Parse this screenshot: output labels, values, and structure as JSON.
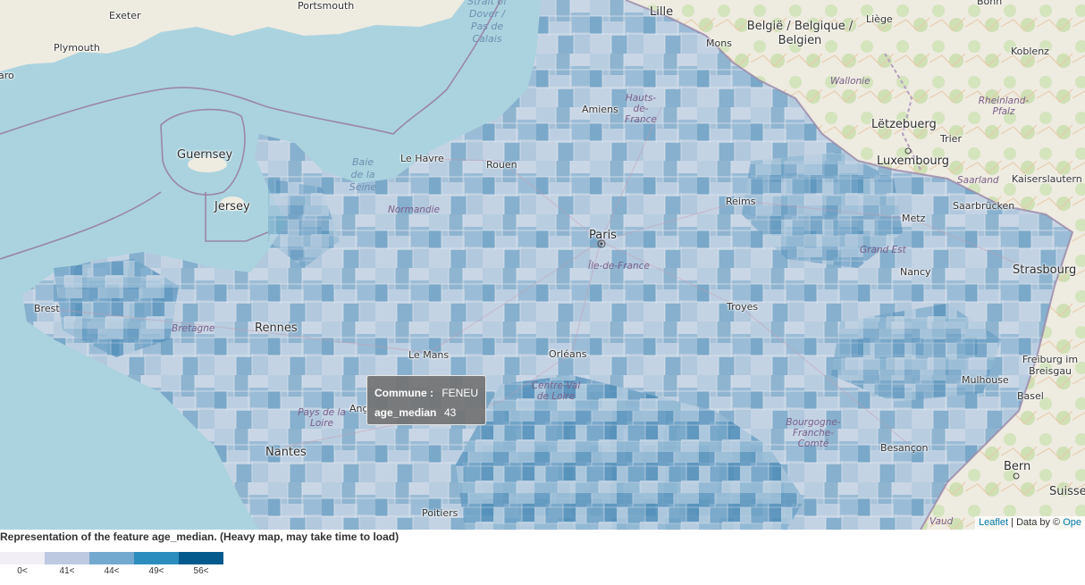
{
  "map": {
    "places": [
      {
        "name": "exeter-label",
        "text": "Exeter",
        "cls": "place"
      },
      {
        "name": "plymouth-label",
        "text": "Plymouth",
        "cls": "place"
      },
      {
        "name": "portsmouth-label",
        "text": "Portsmouth",
        "cls": "place"
      },
      {
        "name": "detroit-dover-label",
        "text": "Strait of Dover / Pas de Calais",
        "cls": "place sea"
      },
      {
        "name": "lille-label",
        "text": "Lille",
        "cls": "place big"
      },
      {
        "name": "belgie-label",
        "text": "België / Belgique / Belgien",
        "cls": "place country"
      },
      {
        "name": "mons-label",
        "text": "Mons",
        "cls": "place"
      },
      {
        "name": "liege-label",
        "text": "Liège",
        "cls": "place"
      },
      {
        "name": "bonn-label",
        "text": "Bonn",
        "cls": "place"
      },
      {
        "name": "koblenz-label",
        "text": "Koblenz",
        "cls": "place"
      },
      {
        "name": "wallonie-label",
        "text": "Wallonie",
        "cls": "place region"
      },
      {
        "name": "rheinland-label",
        "text": "Rheinland-Pfalz",
        "cls": "place region"
      },
      {
        "name": "letzebuerg-label",
        "text": "Lëtzebuerg",
        "cls": "place big"
      },
      {
        "name": "luxembourg-label",
        "text": "Luxembourg",
        "cls": "place big"
      },
      {
        "name": "trier-label",
        "text": "Trier",
        "cls": "place"
      },
      {
        "name": "saarland-label",
        "text": "Saarland",
        "cls": "place region"
      },
      {
        "name": "kaiserslautern-label",
        "text": "Kaiserslautern",
        "cls": "place"
      },
      {
        "name": "saarbrucken-label",
        "text": "Saarbrücken",
        "cls": "place"
      },
      {
        "name": "metz-label",
        "text": "Metz",
        "cls": "place"
      },
      {
        "name": "grand-est-label",
        "text": "Grand Est",
        "cls": "place region"
      },
      {
        "name": "nancy-label",
        "text": "Nancy",
        "cls": "place"
      },
      {
        "name": "strasbourg-label",
        "text": "Strasbourg",
        "cls": "place big"
      },
      {
        "name": "freiburg-label",
        "text": "Freiburg im Breisgau",
        "cls": "place"
      },
      {
        "name": "mulhouse-label",
        "text": "Mulhouse",
        "cls": "place"
      },
      {
        "name": "basel-label",
        "text": "Basel",
        "cls": "place"
      },
      {
        "name": "bern-label",
        "text": "Bern",
        "cls": "place big"
      },
      {
        "name": "suisse-label",
        "text": "Suisse",
        "cls": "place country"
      },
      {
        "name": "vaud-label",
        "text": "Vaud",
        "cls": "place region"
      },
      {
        "name": "besancon-label",
        "text": "Besançon",
        "cls": "place"
      },
      {
        "name": "bourgogne-label",
        "text": "Bourgogne-Franche-Comté",
        "cls": "place region"
      },
      {
        "name": "troyes-label",
        "text": "Troyes",
        "cls": "place"
      },
      {
        "name": "reims-label",
        "text": "Reims",
        "cls": "place"
      },
      {
        "name": "amiens-label",
        "text": "Amiens",
        "cls": "place"
      },
      {
        "name": "hauts-de-france-label",
        "text": "Hauts-de-France",
        "cls": "place region"
      },
      {
        "name": "guernsey-label",
        "text": "Guernsey",
        "cls": "place big"
      },
      {
        "name": "jersey-label",
        "text": "Jersey",
        "cls": "place big"
      },
      {
        "name": "baie-de-seine-label",
        "text": "Baie de la Seine",
        "cls": "place sea"
      },
      {
        "name": "le-havre-label",
        "text": "Le Havre",
        "cls": "place"
      },
      {
        "name": "rouen-label",
        "text": "Rouen",
        "cls": "place"
      },
      {
        "name": "normandie-label",
        "text": "Normandie",
        "cls": "place region"
      },
      {
        "name": "paris-label",
        "text": "Paris",
        "cls": "place big"
      },
      {
        "name": "ile-de-france-label",
        "text": "Île-de-France",
        "cls": "place region"
      },
      {
        "name": "brest-label",
        "text": "Brest",
        "cls": "place"
      },
      {
        "name": "bretagne-label",
        "text": "Bretagne",
        "cls": "place region"
      },
      {
        "name": "rennes-label",
        "text": "Rennes",
        "cls": "place big"
      },
      {
        "name": "le-mans-label",
        "text": "Le Mans",
        "cls": "place"
      },
      {
        "name": "orleans-label",
        "text": "Orléans",
        "cls": "place"
      },
      {
        "name": "centre-val-de-loire-label",
        "text": "Centre-Val de Loire",
        "cls": "place region"
      },
      {
        "name": "pays-de-la-loire-label",
        "text": "Pays de la Loire",
        "cls": "place region"
      },
      {
        "name": "angers-label",
        "text": "Ang",
        "cls": "place"
      },
      {
        "name": "nantes-label",
        "text": "Nantes",
        "cls": "place big"
      },
      {
        "name": "poitiers-label",
        "text": "Poitiers",
        "cls": "place"
      },
      {
        "name": "aro-label",
        "text": "aro",
        "cls": "place"
      }
    ],
    "tooltip": {
      "commune_key": "Commune :",
      "commune_value": "FENEU",
      "age_key": "age_median",
      "age_value": "43"
    },
    "attribution": {
      "leaflet": "Leaflet",
      "data_by": "| Data by ©",
      "osm": "Ope"
    }
  },
  "caption": "Representation of the feature age_median. (Heavy map, may take time to load)",
  "legend": {
    "items": [
      {
        "label": "0<",
        "color": "#f1eef6"
      },
      {
        "label": "41<",
        "color": "#bdc9e1"
      },
      {
        "label": "44<",
        "color": "#74a9cf"
      },
      {
        "label": "49<",
        "color": "#2b8cbe"
      },
      {
        "label": "56<",
        "color": "#045a8d"
      }
    ]
  },
  "colors": {
    "sea": "#aad3df",
    "land_foreign": "#eeebe0",
    "forest": "#cfe0b5",
    "boundary": "#9b86a8",
    "choropleth_base": "#9dbbd3"
  }
}
